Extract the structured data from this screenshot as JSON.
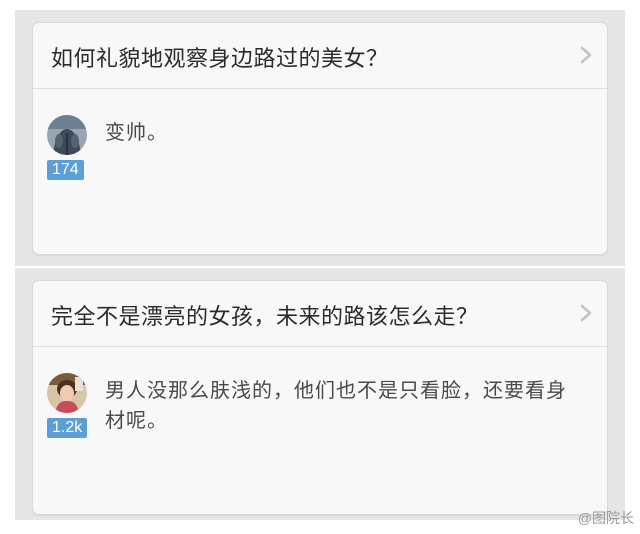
{
  "cards": [
    {
      "question": "如何礼貌地观察身边路过的美女？",
      "answer": "变帅。",
      "votes": "174",
      "chevron_icon": "chevron-right-icon",
      "avatar_icon": "user-avatar-photo"
    },
    {
      "question": "完全不是漂亮的女孩，未来的路该怎么走？",
      "answer": "男人没那么肤浅的，他们也不是只看脸，还要看身材呢。",
      "votes": "1.2k",
      "chevron_icon": "chevron-right-icon",
      "avatar_icon": "user-avatar-photo"
    }
  ],
  "watermark": "@图院长",
  "colors": {
    "background": "#e6e6e6",
    "card": "#f8f8f8",
    "badge": "#5b9fd6",
    "title": "#2b2b2b",
    "answer": "#4a4a4a"
  }
}
